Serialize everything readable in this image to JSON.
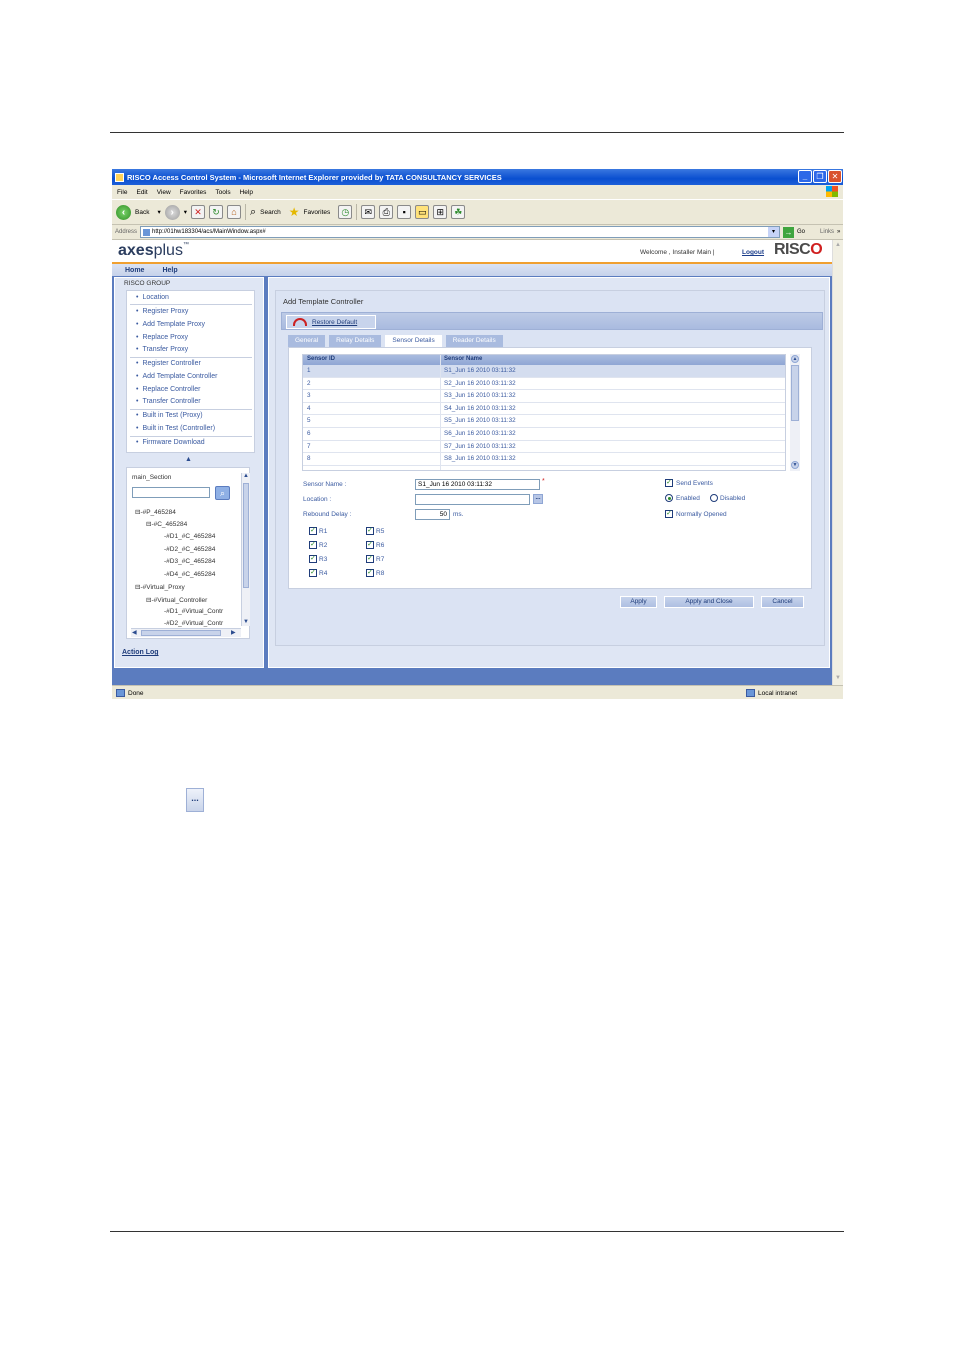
{
  "window": {
    "title": "RISCO Access Control System - Microsoft Internet Explorer provided by TATA CONSULTANCY SERVICES",
    "controls": [
      "_",
      "❐",
      "✕"
    ]
  },
  "menu": [
    "File",
    "Edit",
    "View",
    "Favorites",
    "Tools",
    "Help"
  ],
  "toolbar": {
    "back": "Back",
    "search": "Search",
    "favorites": "Favorites"
  },
  "address": {
    "label": "Address",
    "url": "http://01hw183304/acs/MainWindow.aspx#",
    "go": "Go",
    "links": "Links",
    "more": "»"
  },
  "app": {
    "logo_bold": "axes",
    "logo_light": "plus",
    "logo_tm": "™",
    "welcome": "Welcome , Installer Main |",
    "logout": "Logout",
    "brand": "RISC",
    "brand_o": "O"
  },
  "nav": [
    "Home",
    "Help"
  ],
  "sidebar": {
    "group": "RISCO GROUP",
    "items": [
      "Location",
      "Register Proxy",
      "Add Template Proxy",
      "Replace Proxy",
      "Transfer Proxy",
      "Register Controller",
      "Add Template Controller",
      "Replace Controller",
      "Transfer Controller",
      "Built in Test (Proxy)",
      "Built in Test (Controller)",
      "Firmware Download"
    ],
    "collapse": "▲",
    "tree_title": "main_Section",
    "tree": [
      "⊟-#P_465284",
      "⊟-#C_465284",
      "-#D1_#C_465284",
      "-#D2_#C_465284",
      "-#D3_#C_465284",
      "-#D4_#C_465284",
      "⊟-#Virtual_Proxy",
      "⊟-#Virtual_Controller",
      "-#D1_#Virtual_Contr",
      "-#D2_#Virtual_Contr"
    ],
    "action_log": "Action Log"
  },
  "main": {
    "title": "Add Template Controller",
    "restore": "Restore Default",
    "tabs": [
      "General",
      "Relay Details",
      "Sensor Details",
      "Reader Details"
    ],
    "active_tab": 2,
    "grid": {
      "headers": [
        "Sensor ID",
        "Sensor Name"
      ],
      "rows": [
        [
          "1",
          "S1_Jun 16 2010 03:11:32"
        ],
        [
          "2",
          "S2_Jun 16 2010 03:11:32"
        ],
        [
          "3",
          "S3_Jun 16 2010 03:11:32"
        ],
        [
          "4",
          "S4_Jun 16 2010 03:11:32"
        ],
        [
          "5",
          "S5_Jun 16 2010 03:11:32"
        ],
        [
          "6",
          "S6_Jun 16 2010 03:11:32"
        ],
        [
          "7",
          "S7_Jun 16 2010 03:11:32"
        ],
        [
          "8",
          "S8_Jun 16 2010 03:11:32"
        ]
      ]
    },
    "form": {
      "sensor_name_label": "Sensor Name :",
      "sensor_name_value": "S1_Jun 16 2010 03:11:32",
      "required": "*",
      "location_label": "Location :",
      "location_value": "",
      "rebound_label": "Rebound Delay :",
      "rebound_value": "50",
      "rebound_unit": "ms.",
      "ellipsis": "...",
      "relays_left": [
        "R1",
        "R2",
        "R3",
        "R4"
      ],
      "relays_right": [
        "R5",
        "R6",
        "R7",
        "R8"
      ],
      "send_events": "Send Events",
      "enabled": "Enabled",
      "disabled": "Disabled",
      "normally_opened": "Normally Opened"
    },
    "buttons": {
      "apply": "Apply",
      "apply_close": "Apply and Close",
      "cancel": "Cancel"
    }
  },
  "status": {
    "done": "Done",
    "zone": "Local intranet"
  },
  "solo_button": "..."
}
